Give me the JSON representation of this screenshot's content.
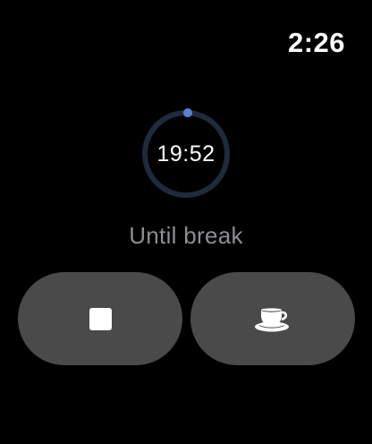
{
  "status_bar": {
    "time": "2:26"
  },
  "timer": {
    "remaining": "19:52",
    "subtitle": "Until break",
    "progress_fraction": 0.007,
    "ring_track_color": "#1f2a3d",
    "ring_progress_color": "#5b7fcf"
  },
  "actions": {
    "stop": {
      "icon": "stop-icon"
    },
    "take_break": {
      "icon": "coffee-cup-icon"
    },
    "button_color": "#4a4a4a"
  }
}
